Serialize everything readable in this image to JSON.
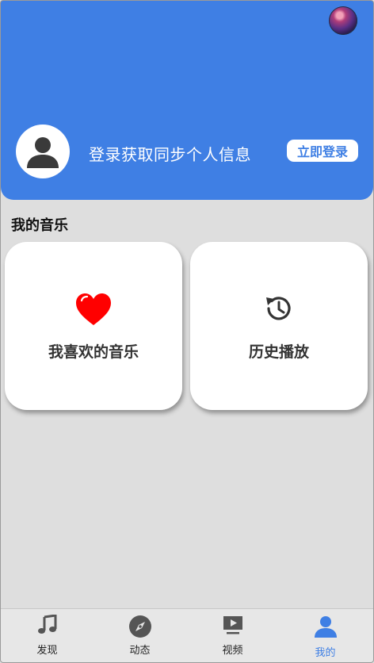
{
  "header": {
    "background_color": "#3f7fe4",
    "top_avatar_icon": "profile-picture",
    "login_prompt": "登录获取同步个人信息",
    "login_button": "立即登录"
  },
  "my_music": {
    "title": "我的音乐",
    "cards": [
      {
        "label": "我喜欢的音乐",
        "icon": "heart-icon",
        "icon_color": "#ff0000"
      },
      {
        "label": "历史播放",
        "icon": "history-icon",
        "icon_color": "#333333"
      }
    ]
  },
  "bottom_nav": {
    "active_color": "#3f7fe4",
    "items": [
      {
        "label": "发现",
        "icon": "music-note-icon"
      },
      {
        "label": "动态",
        "icon": "compass-icon"
      },
      {
        "label": "视频",
        "icon": "video-play-icon"
      },
      {
        "label": "我的",
        "icon": "person-icon",
        "active": true
      }
    ]
  }
}
